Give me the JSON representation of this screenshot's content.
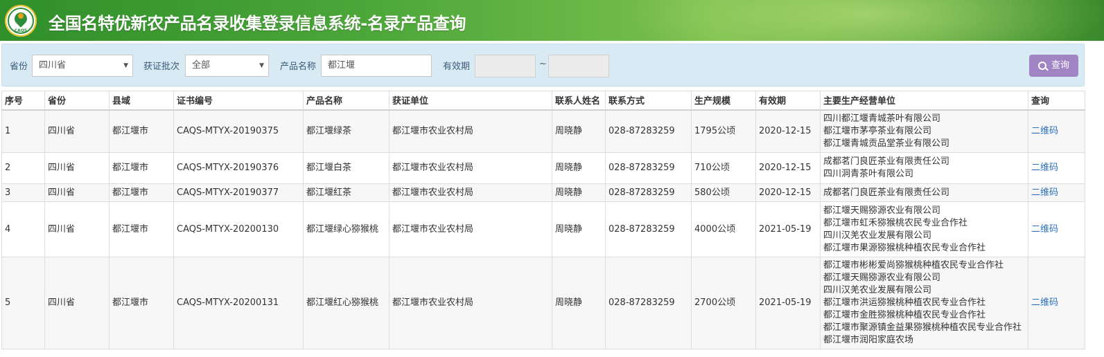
{
  "header": {
    "title": "全国名特优新农产品名录收集登录信息系统-名录产品查询",
    "logo_text": "CAQS"
  },
  "filters": {
    "province_label": "省份",
    "province_value": "四川省",
    "batch_label": "获证批次",
    "batch_value": "全部",
    "product_label": "产品名称",
    "product_value": "都江堰",
    "validity_label": "有效期",
    "validity_separator": "~",
    "query_label": "查询"
  },
  "table": {
    "columns": [
      "序号",
      "省份",
      "县域",
      "证书编号",
      "产品名称",
      "获证单位",
      "联系人姓名",
      "联系方式",
      "生产规模",
      "有效期",
      "主要生产经营单位",
      "查询"
    ],
    "rows": [
      {
        "no": "1",
        "province": "四川省",
        "county": "都江堰市",
        "cert": "CAQS-MTYX-20190375",
        "product": "都江堰绿茶",
        "org": "都江堰市农业农村局",
        "contact": "周晓静",
        "phone": "028-87283259",
        "scale": "1795公顷",
        "valid": "2020-12-15",
        "units": [
          "四川都江堰青城茶叶有限公司",
          "都江堰市茅亭茶业有限公司",
          "都江堰青城贡品堂茶业有限公司"
        ],
        "qr": "二维码"
      },
      {
        "no": "2",
        "province": "四川省",
        "county": "都江堰市",
        "cert": "CAQS-MTYX-20190376",
        "product": "都江堰白茶",
        "org": "都江堰市农业农村局",
        "contact": "周晓静",
        "phone": "028-87283259",
        "scale": "710公顷",
        "valid": "2020-12-15",
        "units": [
          "成都茗门良匠茶业有限责任公司",
          "四川洞青茶叶有限公司"
        ],
        "qr": "二维码"
      },
      {
        "no": "3",
        "province": "四川省",
        "county": "都江堰市",
        "cert": "CAQS-MTYX-20190377",
        "product": "都江堰红茶",
        "org": "都江堰市农业农村局",
        "contact": "周晓静",
        "phone": "028-87283259",
        "scale": "580公顷",
        "valid": "2020-12-15",
        "units": [
          "成都茗门良匠茶业有限责任公司"
        ],
        "qr": "二维码"
      },
      {
        "no": "4",
        "province": "四川省",
        "county": "都江堰市",
        "cert": "CAQS-MTYX-20200130",
        "product": "都江堰绿心猕猴桃",
        "org": "都江堰市农业农村局",
        "contact": "周晓静",
        "phone": "028-87283259",
        "scale": "4000公顷",
        "valid": "2021-05-19",
        "units": [
          "都江堰天赐猕源农业有限公司",
          "都江堰市虹禾猕猴桃农民专业合作社",
          "四川汉羌农业发展有限公司",
          "都江堰市果源猕猴桃种植农民专业合作社"
        ],
        "qr": "二维码"
      },
      {
        "no": "5",
        "province": "四川省",
        "county": "都江堰市",
        "cert": "CAQS-MTYX-20200131",
        "product": "都江堰红心猕猴桃",
        "org": "都江堰市农业农村局",
        "contact": "周晓静",
        "phone": "028-87283259",
        "scale": "2700公顷",
        "valid": "2021-05-19",
        "units": [
          "都江堰市彬彬爱尚猕猴桃种植农民专业合作社",
          "都江堰天赐猕源农业有限公司",
          "四川汉羌农业发展有限公司",
          "都江堰市洪运猕猴桃种植农民专业合作社",
          "都江堰市金胜猕猴桃种植农民专业合作社",
          "都江堰市聚源镇金益果猕猴桃种植农民专业合作社",
          "都江堰市润阳家庭农场"
        ],
        "qr": "二维码"
      }
    ]
  }
}
